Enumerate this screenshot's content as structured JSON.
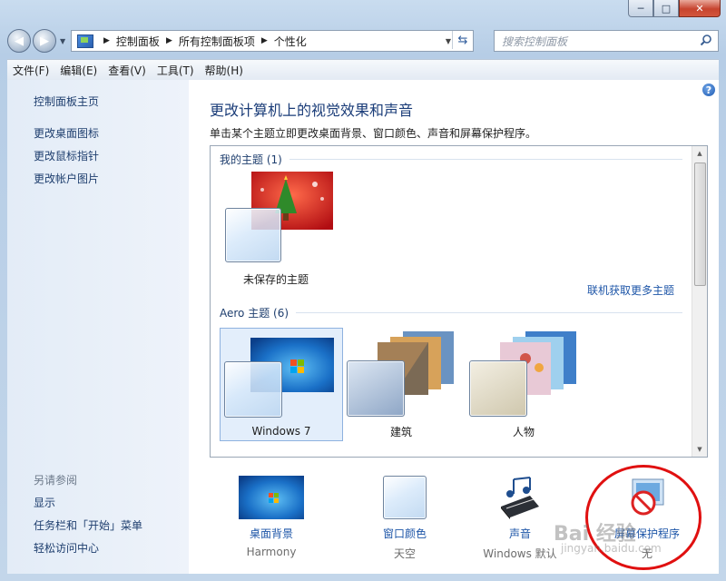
{
  "window": {
    "min": "─",
    "max": "□",
    "close": "✕"
  },
  "address": {
    "crumbs": [
      "控制面板",
      "所有控制面板项",
      "个性化"
    ]
  },
  "search": {
    "placeholder": "搜索控制面板"
  },
  "menu": [
    "文件(F)",
    "编辑(E)",
    "查看(V)",
    "工具(T)",
    "帮助(H)"
  ],
  "sidebar": {
    "links": [
      "控制面板主页",
      "更改桌面图标",
      "更改鼠标指针",
      "更改帐户图片"
    ],
    "see_also_title": "另请参阅",
    "see_also": [
      "显示",
      "任务栏和「开始」菜单",
      "轻松访问中心"
    ]
  },
  "main": {
    "heading": "更改计算机上的视觉效果和声音",
    "description": "单击某个主题立即更改桌面背景、窗口颜色、声音和屏幕保护程序。",
    "my_themes_header": "我的主题 (1)",
    "my_themes": [
      {
        "name": "未保存的主题"
      }
    ],
    "get_more": "联机获取更多主题",
    "aero_header": "Aero 主题 (6)",
    "aero_themes": [
      {
        "name": "Windows 7",
        "selected": true
      },
      {
        "name": "建筑",
        "selected": false
      },
      {
        "name": "人物",
        "selected": false
      }
    ]
  },
  "bottom": [
    {
      "title": "桌面背景",
      "value": "Harmony"
    },
    {
      "title": "窗口颜色",
      "value": "天空"
    },
    {
      "title": "声音",
      "value": "Windows 默认"
    },
    {
      "title": "屏幕保护程序",
      "value": "无"
    }
  ],
  "watermark": {
    "main": "Bai 经验",
    "sub": "jingyan.baidu.com"
  },
  "colors": {
    "accent": "#1e56a8",
    "heading": "#1a3c78",
    "highlight_circle": "#e01010"
  },
  "icons": [
    "back-arrow-icon",
    "forward-arrow-icon",
    "control-panel-icon",
    "refresh-icon",
    "search-icon",
    "help-icon",
    "no-entry-icon",
    "music-notes-icon"
  ]
}
